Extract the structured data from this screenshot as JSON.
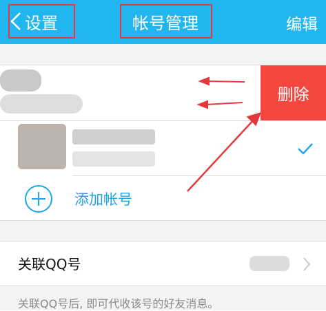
{
  "nav": {
    "back_label": "设置",
    "title": "帐号管理",
    "edit_label": "编辑"
  },
  "accounts": {
    "delete_label": "删除",
    "add_label": "添加帐号"
  },
  "linked": {
    "label": "关联QQ号",
    "note": "关联QQ号后, 即可代收该号的好友消息。"
  },
  "colors": {
    "nav_bg": "#21b6ef",
    "accent": "#1da6e8",
    "delete_bg": "#f5463f",
    "annotation_red": "#e23a3a"
  },
  "icons": [
    "chevron-left-icon",
    "check-icon",
    "add-circle-icon",
    "chevron-right-icon"
  ]
}
